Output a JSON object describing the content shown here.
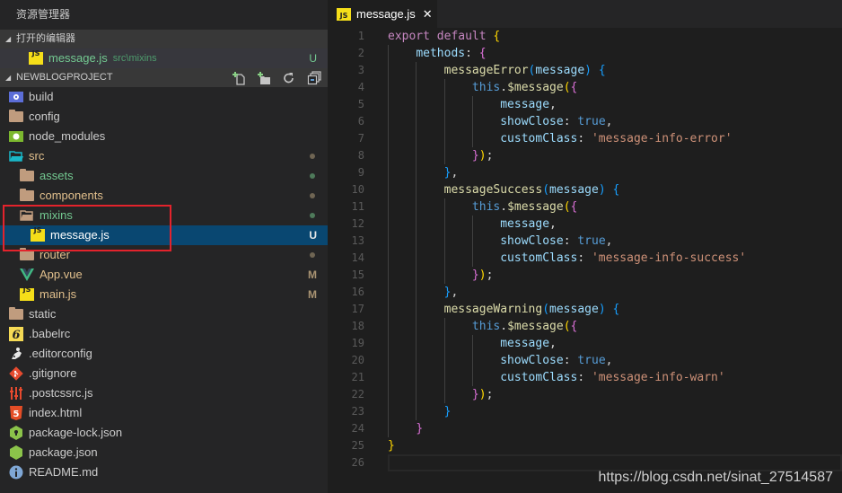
{
  "sidebar": {
    "title": "资源管理器",
    "open_editors": {
      "header": "打开的编辑器",
      "items": [
        {
          "name": "message.js",
          "path": "src\\mixins",
          "icon": "js-icon",
          "status": "U"
        }
      ]
    },
    "project": {
      "header": "NEWBLOGPROJECT",
      "actions": [
        {
          "name": "new-file-icon",
          "label": "New File"
        },
        {
          "name": "new-folder-icon",
          "label": "New Folder"
        },
        {
          "name": "refresh-icon",
          "label": "Refresh"
        },
        {
          "name": "collapse-all-icon",
          "label": "Collapse All"
        }
      ],
      "tree": [
        {
          "name": "build",
          "icon": "build-folder-icon",
          "depth": 0
        },
        {
          "name": "config",
          "icon": "folder-icon",
          "depth": 0
        },
        {
          "name": "node_modules",
          "icon": "node-folder-icon",
          "depth": 0
        },
        {
          "name": "src",
          "icon": "src-folder-open-icon",
          "depth": 0,
          "status": "dot-modified"
        },
        {
          "name": "assets",
          "icon": "folder-icon",
          "depth": 1,
          "status": "dot-untracked"
        },
        {
          "name": "components",
          "icon": "folder-icon",
          "depth": 1,
          "status": "dot-modified"
        },
        {
          "name": "mixins",
          "icon": "folder-open-icon",
          "depth": 1,
          "status": "dot-untracked"
        },
        {
          "name": "message.js",
          "icon": "js-icon",
          "depth": 2,
          "status": "U",
          "selected": true
        },
        {
          "name": "router",
          "icon": "folder-icon",
          "depth": 1,
          "status": "dot-modified"
        },
        {
          "name": "App.vue",
          "icon": "vue-icon",
          "depth": 1,
          "status": "M"
        },
        {
          "name": "main.js",
          "icon": "js-icon",
          "depth": 1,
          "status": "M"
        },
        {
          "name": "static",
          "icon": "folder-icon",
          "depth": 0
        },
        {
          "name": ".babelrc",
          "icon": "babel-icon",
          "depth": 0
        },
        {
          "name": ".editorconfig",
          "icon": "editorconfig-icon",
          "depth": 0
        },
        {
          "name": ".gitignore",
          "icon": "git-icon",
          "depth": 0
        },
        {
          "name": ".postcssrc.js",
          "icon": "postcss-icon",
          "depth": 0
        },
        {
          "name": "index.html",
          "icon": "html5-icon",
          "depth": 0
        },
        {
          "name": "package-lock.json",
          "icon": "npm-lock-icon",
          "depth": 0
        },
        {
          "name": "package.json",
          "icon": "npm-icon",
          "depth": 0
        },
        {
          "name": "README.md",
          "icon": "info-icon",
          "depth": 0
        }
      ]
    }
  },
  "editor": {
    "tab": {
      "label": "message.js",
      "close": "✕",
      "icon": "js-icon"
    },
    "lines": [
      [
        [
          "kw",
          "export"
        ],
        [
          "pun",
          " "
        ],
        [
          "kw",
          "default"
        ],
        [
          "pun",
          " "
        ],
        [
          "b1",
          "{"
        ]
      ],
      [
        [
          "pun",
          "    "
        ],
        [
          "prop",
          "methods"
        ],
        [
          "pun",
          ": "
        ],
        [
          "b2",
          "{"
        ]
      ],
      [
        [
          "pun",
          "        "
        ],
        [
          "fn",
          "messageError"
        ],
        [
          "b3",
          "("
        ],
        [
          "par",
          "message"
        ],
        [
          "b3",
          ")"
        ],
        [
          "pun",
          " "
        ],
        [
          "b3",
          "{"
        ]
      ],
      [
        [
          "pun",
          "            "
        ],
        [
          "this",
          "this"
        ],
        [
          "pun",
          "."
        ],
        [
          "fn",
          "$message"
        ],
        [
          "b1",
          "("
        ],
        [
          "b2",
          "{"
        ]
      ],
      [
        [
          "pun",
          "                "
        ],
        [
          "prop",
          "message"
        ],
        [
          "pun",
          ","
        ]
      ],
      [
        [
          "pun",
          "                "
        ],
        [
          "prop",
          "showClose"
        ],
        [
          "pun",
          ": "
        ],
        [
          "bool",
          "true"
        ],
        [
          "pun",
          ","
        ]
      ],
      [
        [
          "pun",
          "                "
        ],
        [
          "prop",
          "customClass"
        ],
        [
          "pun",
          ": "
        ],
        [
          "str",
          "'message-info-error'"
        ]
      ],
      [
        [
          "pun",
          "            "
        ],
        [
          "b2",
          "}"
        ],
        [
          "b1",
          ")"
        ],
        [
          "pun",
          ";"
        ]
      ],
      [
        [
          "pun",
          "        "
        ],
        [
          "b3",
          "}"
        ],
        [
          "pun",
          ","
        ]
      ],
      [
        [
          "pun",
          "        "
        ],
        [
          "fn",
          "messageSuccess"
        ],
        [
          "b3",
          "("
        ],
        [
          "par",
          "message"
        ],
        [
          "b3",
          ")"
        ],
        [
          "pun",
          " "
        ],
        [
          "b3",
          "{"
        ]
      ],
      [
        [
          "pun",
          "            "
        ],
        [
          "this",
          "this"
        ],
        [
          "pun",
          "."
        ],
        [
          "fn",
          "$message"
        ],
        [
          "b1",
          "("
        ],
        [
          "b2",
          "{"
        ]
      ],
      [
        [
          "pun",
          "                "
        ],
        [
          "prop",
          "message"
        ],
        [
          "pun",
          ","
        ]
      ],
      [
        [
          "pun",
          "                "
        ],
        [
          "prop",
          "showClose"
        ],
        [
          "pun",
          ": "
        ],
        [
          "bool",
          "true"
        ],
        [
          "pun",
          ","
        ]
      ],
      [
        [
          "pun",
          "                "
        ],
        [
          "prop",
          "customClass"
        ],
        [
          "pun",
          ": "
        ],
        [
          "str",
          "'message-info-success'"
        ]
      ],
      [
        [
          "pun",
          "            "
        ],
        [
          "b2",
          "}"
        ],
        [
          "b1",
          ")"
        ],
        [
          "pun",
          ";"
        ]
      ],
      [
        [
          "pun",
          "        "
        ],
        [
          "b3",
          "}"
        ],
        [
          "pun",
          ","
        ]
      ],
      [
        [
          "pun",
          "        "
        ],
        [
          "fn",
          "messageWarning"
        ],
        [
          "b3",
          "("
        ],
        [
          "par",
          "message"
        ],
        [
          "b3",
          ")"
        ],
        [
          "pun",
          " "
        ],
        [
          "b3",
          "{"
        ]
      ],
      [
        [
          "pun",
          "            "
        ],
        [
          "this",
          "this"
        ],
        [
          "pun",
          "."
        ],
        [
          "fn",
          "$message"
        ],
        [
          "b1",
          "("
        ],
        [
          "b2",
          "{"
        ]
      ],
      [
        [
          "pun",
          "                "
        ],
        [
          "prop",
          "message"
        ],
        [
          "pun",
          ","
        ]
      ],
      [
        [
          "pun",
          "                "
        ],
        [
          "prop",
          "showClose"
        ],
        [
          "pun",
          ": "
        ],
        [
          "bool",
          "true"
        ],
        [
          "pun",
          ","
        ]
      ],
      [
        [
          "pun",
          "                "
        ],
        [
          "prop",
          "customClass"
        ],
        [
          "pun",
          ": "
        ],
        [
          "str",
          "'message-info-warn'"
        ]
      ],
      [
        [
          "pun",
          "            "
        ],
        [
          "b2",
          "}"
        ],
        [
          "b1",
          ")"
        ],
        [
          "pun",
          ";"
        ]
      ],
      [
        [
          "pun",
          "        "
        ],
        [
          "b3",
          "}"
        ]
      ],
      [
        [
          "pun",
          "    "
        ],
        [
          "b2",
          "}"
        ]
      ],
      [
        [
          "b1",
          "}"
        ]
      ],
      []
    ],
    "current_line": 26
  },
  "watermark": "https://blog.csdn.net/sinat_27514587"
}
